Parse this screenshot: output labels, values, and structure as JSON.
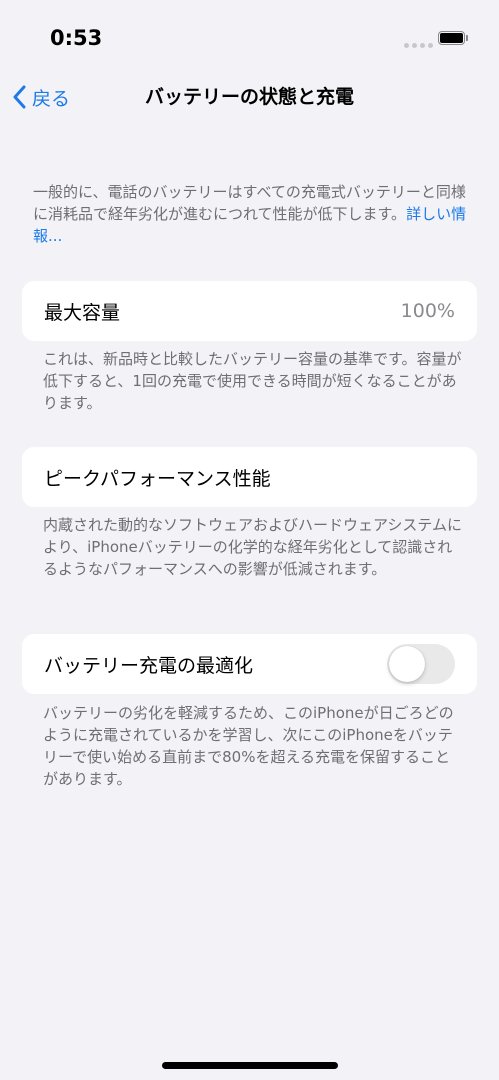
{
  "status_bar": {
    "time": "0:53"
  },
  "nav": {
    "back_label": "戻る",
    "title": "バッテリーの状態と充電"
  },
  "intro": {
    "text": "一般的に、電話のバッテリーはすべての充電式バッテリーと同様に消耗品で経年劣化が進むにつれて性能が低下します。",
    "link": "詳しい情報..."
  },
  "max_capacity": {
    "label": "最大容量",
    "value": "100%",
    "footnote": "これは、新品時と比較したバッテリー容量の基準です。容量が低下すると、1回の充電で使用できる時間が短くなることがあります。"
  },
  "peak_performance": {
    "label": "ピークパフォーマンス性能",
    "footnote": "内蔵された動的なソフトウェアおよびハードウェアシステムにより、iPhoneバッテリーの化学的な経年劣化として認識されるようなパフォーマンスへの影響が低減されます。"
  },
  "optimized_charging": {
    "label": "バッテリー充電の最適化",
    "enabled": false,
    "footnote": "バッテリーの劣化を軽減するため、このiPhoneが日ごろどのように充電されているかを学習し、次にこのiPhoneをバッテリーで使い始める直前まで80%を超える充電を保留することがあります。"
  },
  "colors": {
    "accent": "#1d7ae8",
    "background": "#f2f2f7",
    "toggle_off": "#e9e9ea"
  }
}
